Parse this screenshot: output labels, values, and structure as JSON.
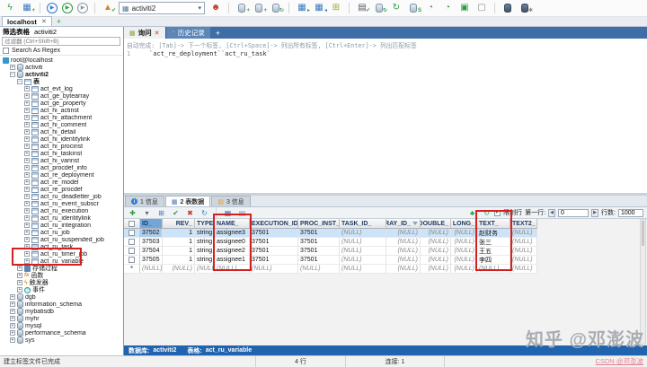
{
  "window": {
    "tab_label": "localhost",
    "close_label": "✕",
    "new_tab_label": "+",
    "status_message": "建立标签文件已完成",
    "status_rows": "4 行",
    "status_connections": "连接: 1"
  },
  "toolbar": {
    "database_selector": "activiti2",
    "left_icons": [
      {
        "name": "connect-icon",
        "glyph": "ϟ",
        "color": "#2e9e44"
      },
      {
        "name": "new-connection-icon",
        "glyph": "▦",
        "color": "#3a7abd",
        "badge": "+",
        "badgeColor": "#2e9e44"
      },
      {
        "sep": true
      },
      {
        "name": "execute-query-icon",
        "glyph": "▶",
        "color": "#2f7bd0",
        "circle": true
      },
      {
        "name": "execute-all-queries-icon",
        "glyph": "▶",
        "color": "#2e9e44",
        "circle": true
      },
      {
        "name": "explain-query-icon",
        "glyph": "▶",
        "color": "#8899aa",
        "circle": true
      },
      {
        "sep": true
      },
      {
        "name": "query-profiler-icon",
        "glyph": "▲",
        "color": "#d9822b",
        "badge": "✔",
        "badgeColor": "#2e9e44"
      }
    ],
    "right_icons": [
      {
        "name": "user-management-icon",
        "glyph": "☻",
        "color": "#c23b2e"
      },
      {
        "sep": true
      },
      {
        "name": "create-database-icon",
        "type": "db",
        "badge": "+",
        "badgeColor": "#2e9e44"
      },
      {
        "name": "create-table-icon",
        "type": "db",
        "badge": "+",
        "badgeColor": "#2e9e44"
      },
      {
        "name": "refresh-database-icon",
        "type": "db",
        "badge": "↻",
        "badgeColor": "#2e9e44"
      },
      {
        "sep": true
      },
      {
        "name": "export-table-icon",
        "glyph": "▦",
        "color": "#3a7abd",
        "badge": "▸",
        "badgeColor": "#2e9e44"
      },
      {
        "name": "import-table-icon",
        "glyph": "▦",
        "color": "#3a7abd",
        "badge": "◂",
        "badgeColor": "#2f7bd0"
      },
      {
        "name": "copy-table-icon",
        "glyph": "⊞",
        "color": "#9aa43c"
      },
      {
        "sep": true
      },
      {
        "name": "schema-sync-icon",
        "glyph": "▤",
        "color": "#556",
        "badge": "✔",
        "badgeColor": "#2e9e44"
      },
      {
        "name": "data-sync-icon",
        "type": "db",
        "badge": "↻",
        "badgeColor": "#2e9e44"
      },
      {
        "name": "refresh-icon",
        "glyph": "↻",
        "color": "#2e9e44"
      },
      {
        "name": "backup-database-icon",
        "type": "db",
        "badge": "S",
        "badgeColor": "#2e9e44"
      },
      {
        "name": "query-history-icon",
        "glyph": "◔",
        "color": "#777777"
      },
      {
        "name": "scheduled-backup-icon",
        "glyph": "◔",
        "color": "#2e9e44"
      },
      {
        "name": "new-window-icon",
        "glyph": "▣",
        "color": "#2e9e44"
      },
      {
        "name": "window-icon",
        "glyph": "▢",
        "color": "#888888"
      },
      {
        "sep": true
      },
      {
        "name": "table-diagnostics-icon",
        "type": "db",
        "dark": true
      },
      {
        "name": "flush-tools-icon",
        "type": "db",
        "dark": true,
        "badge": "✱",
        "badgeColor": "#888888"
      }
    ]
  },
  "sidebar": {
    "filter_title": "筛选表格",
    "filter_database": "activiti2",
    "filter_placeholder": "过滤器 (Ctrl+Shift+B)",
    "regex_label": "Search As Regex",
    "tree": [
      {
        "label": "root@localhost",
        "depth": 0,
        "icon": "conn",
        "expander": "none",
        "bold": false
      },
      {
        "label": "activiti",
        "depth": 1,
        "icon": "db",
        "expander": "plus",
        "bold": false
      },
      {
        "label": "activiti2",
        "depth": 1,
        "icon": "db",
        "expander": "minus",
        "bold": true
      },
      {
        "label": "表",
        "depth": 2,
        "icon": "tbl",
        "expander": "minus",
        "bold": true
      },
      {
        "label": "act_evt_log",
        "depth": 3,
        "icon": "tbl",
        "expander": "plus",
        "bold": false
      },
      {
        "label": "act_ge_bytearray",
        "depth": 3,
        "icon": "tbl",
        "expander": "plus",
        "bold": false
      },
      {
        "label": "act_ge_property",
        "depth": 3,
        "icon": "tbl",
        "expander": "plus",
        "bold": false
      },
      {
        "label": "act_hi_actinst",
        "depth": 3,
        "icon": "tbl",
        "expander": "plus",
        "bold": false
      },
      {
        "label": "act_hi_attachment",
        "depth": 3,
        "icon": "tbl",
        "expander": "plus",
        "bold": false
      },
      {
        "label": "act_hi_comment",
        "depth": 3,
        "icon": "tbl",
        "expander": "plus",
        "bold": false
      },
      {
        "label": "act_hi_detail",
        "depth": 3,
        "icon": "tbl",
        "expander": "plus",
        "bold": false
      },
      {
        "label": "act_hi_identitylink",
        "depth": 3,
        "icon": "tbl",
        "expander": "plus",
        "bold": false
      },
      {
        "label": "act_hi_procinst",
        "depth": 3,
        "icon": "tbl",
        "expander": "plus",
        "bold": false
      },
      {
        "label": "act_hi_taskinst",
        "depth": 3,
        "icon": "tbl",
        "expander": "plus",
        "bold": false
      },
      {
        "label": "act_hi_varinst",
        "depth": 3,
        "icon": "tbl",
        "expander": "plus",
        "bold": false
      },
      {
        "label": "act_procdef_info",
        "depth": 3,
        "icon": "tbl",
        "expander": "plus",
        "bold": false
      },
      {
        "label": "act_re_deployment",
        "depth": 3,
        "icon": "tbl",
        "expander": "plus",
        "bold": false
      },
      {
        "label": "act_re_model",
        "depth": 3,
        "icon": "tbl",
        "expander": "plus",
        "bold": false
      },
      {
        "label": "act_re_procdef",
        "depth": 3,
        "icon": "tbl",
        "expander": "plus",
        "bold": false
      },
      {
        "label": "act_ru_deadletter_job",
        "depth": 3,
        "icon": "tbl",
        "expander": "plus",
        "bold": false
      },
      {
        "label": "act_ru_event_subscr",
        "depth": 3,
        "icon": "tbl",
        "expander": "plus",
        "bold": false
      },
      {
        "label": "act_ru_execution",
        "depth": 3,
        "icon": "tbl",
        "expander": "plus",
        "bold": false
      },
      {
        "label": "act_ru_identitylink",
        "depth": 3,
        "icon": "tbl",
        "expander": "plus",
        "bold": false
      },
      {
        "label": "act_ru_integration",
        "depth": 3,
        "icon": "tbl",
        "expander": "plus",
        "bold": false
      },
      {
        "label": "act_ru_job",
        "depth": 3,
        "icon": "tbl",
        "expander": "plus",
        "bold": false
      },
      {
        "label": "act_ru_suspended_job",
        "depth": 3,
        "icon": "tbl",
        "expander": "plus",
        "bold": false
      },
      {
        "label": "act_ru_task",
        "depth": 3,
        "icon": "tbl",
        "expander": "plus",
        "bold": false
      },
      {
        "label": "act_ru_timer_job",
        "depth": 3,
        "icon": "tbl",
        "expander": "plus",
        "bold": false
      },
      {
        "label": "act_ru_variable",
        "depth": 3,
        "icon": "tbl",
        "expander": "plus",
        "bold": false
      },
      {
        "label": "存储过程",
        "depth": 2,
        "icon": "proc",
        "expander": "plus",
        "bold": false
      },
      {
        "label": "函数",
        "depth": 2,
        "icon": "fx",
        "expander": "plus",
        "bold": false
      },
      {
        "label": "触发器",
        "depth": 2,
        "icon": "trig",
        "expander": "plus",
        "bold": false
      },
      {
        "label": "事件",
        "depth": 2,
        "icon": "evt",
        "expander": "plus",
        "bold": false
      },
      {
        "label": "dgb",
        "depth": 1,
        "icon": "db",
        "expander": "plus",
        "bold": false
      },
      {
        "label": "information_schema",
        "depth": 1,
        "icon": "db",
        "expander": "plus",
        "bold": false
      },
      {
        "label": "mybatisdb",
        "depth": 1,
        "icon": "db",
        "expander": "plus",
        "bold": false
      },
      {
        "label": "myhr",
        "depth": 1,
        "icon": "db",
        "expander": "plus",
        "bold": false
      },
      {
        "label": "mysql",
        "depth": 1,
        "icon": "db",
        "expander": "plus",
        "bold": false
      },
      {
        "label": "performance_schema",
        "depth": 1,
        "icon": "db",
        "expander": "plus",
        "bold": false
      },
      {
        "label": "sys",
        "depth": 1,
        "icon": "db",
        "expander": "plus",
        "bold": false
      }
    ]
  },
  "query": {
    "tabs": [
      {
        "label": "询问"
      },
      {
        "label": "历史记录"
      }
    ],
    "close_label": "✕",
    "add_tab_label": "+",
    "hint": "自动完成: [Tab]-> 下一个标签, [Ctrl+Space]-> 列出所有标签, [Ctrl+Enter]-> 列出匹配标签",
    "line_number": "1",
    "sql": "`act_re_deployment``act_ru_task`"
  },
  "results": {
    "tabs": [
      "1 信息",
      "2 表数据",
      "3 信息"
    ],
    "limit_label": "限制行",
    "first_row_label": "第一行:",
    "first_row_value": "0",
    "row_count_label": "行数:",
    "row_count_value": "1000"
  },
  "grid": {
    "columns": [
      "ID_",
      "REV_",
      "TYPE_",
      "NAME_",
      "EXECUTION_ID_",
      "PROC_INST_ID_",
      "TASK_ID_",
      "BYTEARRAY_ID_",
      "DOUBLE_",
      "LONG_",
      "TEXT_",
      "TEXT2_"
    ],
    "rows": [
      [
        "37502",
        "1",
        "string",
        "assignee3",
        "37501",
        "37501",
        "(NULL)",
        "(NULL)",
        "(NULL)",
        "(NULL)",
        "赵财务",
        "(NULL)"
      ],
      [
        "37503",
        "1",
        "string",
        "assignee0",
        "37501",
        "37501",
        "(NULL)",
        "(NULL)",
        "(NULL)",
        "(NULL)",
        "张三",
        "(NULL)"
      ],
      [
        "37504",
        "1",
        "string",
        "assignee2",
        "37501",
        "37501",
        "(NULL)",
        "(NULL)",
        "(NULL)",
        "(NULL)",
        "王五",
        "(NULL)"
      ],
      [
        "37505",
        "1",
        "string",
        "assignee1",
        "37501",
        "37501",
        "(NULL)",
        "(NULL)",
        "(NULL)",
        "(NULL)",
        "李四",
        "(NULL)"
      ]
    ],
    "new_row_marker": "*",
    "new_row": [
      "(NULL)",
      "(NULL)",
      "(NULL)",
      "(NULL)",
      "(NULL)",
      "(NULL)",
      "(NULL)",
      "(NULL)",
      "(NULL)",
      "(NULL)",
      "(NULL)",
      "(NULL)"
    ]
  },
  "grid_toolbar": {
    "left_icons": [
      {
        "name": "add-row-icon",
        "glyph": "✚",
        "color": "#2e9e44"
      },
      {
        "name": "add-row-menu-icon",
        "glyph": "▾",
        "color": "#556677"
      },
      {
        "name": "duplicate-row-icon",
        "glyph": "⊞",
        "color": "#3a7abd"
      },
      {
        "name": "save-row-icon",
        "glyph": "✔",
        "color": "#2e9e44"
      },
      {
        "name": "delete-row-icon",
        "glyph": "✖",
        "color": "#c0392b"
      },
      {
        "name": "refresh-rows-icon",
        "glyph": "↻",
        "color": "#3a7abd"
      },
      {
        "sep": true
      },
      {
        "name": "grid-view-icon",
        "glyph": "▦",
        "color": "#3a7abd"
      },
      {
        "name": "form-view-icon",
        "glyph": "▤",
        "color": "#7d93ad"
      }
    ],
    "right_icons": [
      {
        "name": "export-data-icon",
        "glyph": "♣",
        "color": "#2e9e44"
      },
      {
        "name": "refresh-data-icon",
        "glyph": "↻",
        "color": "#2e9e44"
      }
    ]
  },
  "grid_status": {
    "db_label": "数据库:",
    "db_value": "activiti2",
    "table_label": "表格:",
    "table_value": "act_ru_variable"
  },
  "watermarks": {
    "zhihu": "知乎 @邓澎波",
    "csdn": "CSDN @邓澎波"
  },
  "colors": {
    "annotation": "#d4201f",
    "statusbar_blue": "#2063ae",
    "selection": "#cde3f7",
    "header_selected": "#73a7da"
  }
}
